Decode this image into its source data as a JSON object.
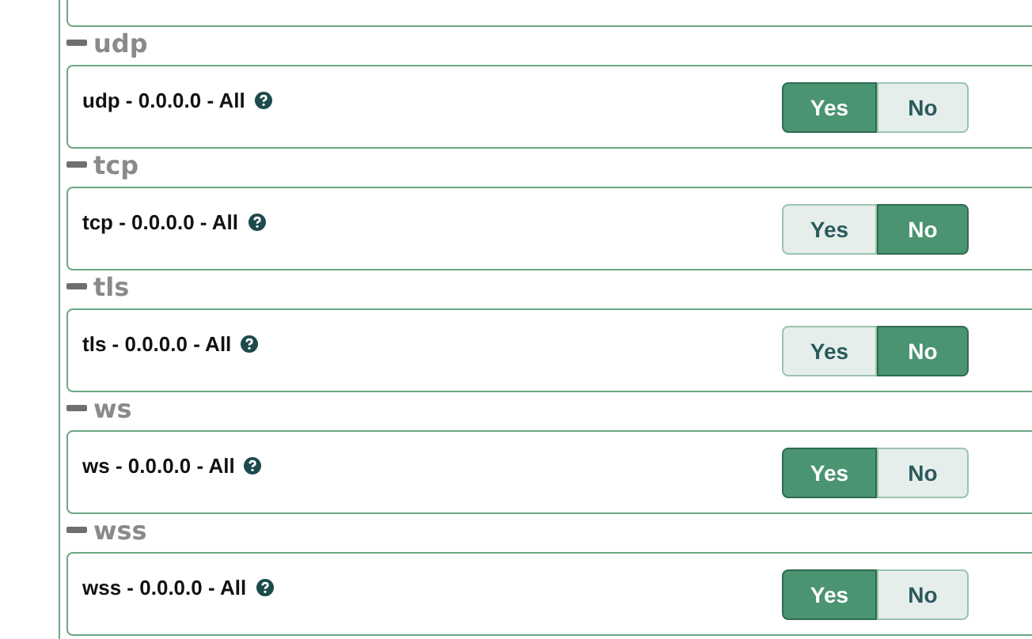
{
  "sections": [
    {
      "title": "udp",
      "label": "udp - 0.0.0.0 - All",
      "options": [
        {
          "label": "Yes",
          "selected": true
        },
        {
          "label": "No",
          "selected": false
        }
      ]
    },
    {
      "title": "tcp",
      "label": "tcp - 0.0.0.0 - All",
      "options": [
        {
          "label": "Yes",
          "selected": false
        },
        {
          "label": "No",
          "selected": true
        }
      ]
    },
    {
      "title": "tls",
      "label": "tls - 0.0.0.0 - All",
      "options": [
        {
          "label": "Yes",
          "selected": false
        },
        {
          "label": "No",
          "selected": true
        }
      ]
    },
    {
      "title": "ws",
      "label": "ws - 0.0.0.0 - All",
      "options": [
        {
          "label": "Yes",
          "selected": true
        },
        {
          "label": "No",
          "selected": false
        }
      ]
    },
    {
      "title": "wss",
      "label": "wss - 0.0.0.0 - All",
      "options": [
        {
          "label": "Yes",
          "selected": true
        },
        {
          "label": "No",
          "selected": false
        }
      ]
    }
  ]
}
